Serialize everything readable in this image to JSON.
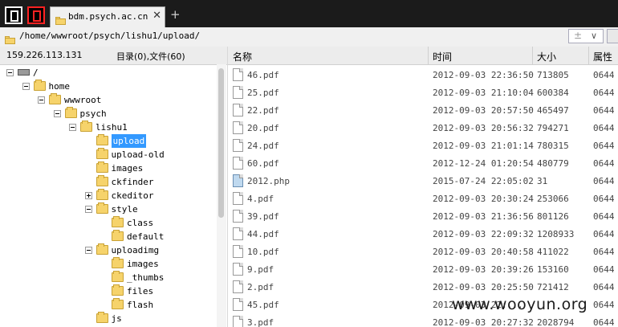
{
  "tab": {
    "title": "bdm.psych.ac.cn",
    "close": "✕"
  },
  "newtab": "+",
  "address": {
    "path": "/home/wwwroot/psych/lishu1/upload/",
    "plus": "±",
    "chevron": "∨"
  },
  "left": {
    "ip": "159.226.113.131",
    "counts": "目录(0),文件(60)",
    "tree": [
      {
        "label": "/",
        "level": 0,
        "icon": "drive-icon",
        "expander": "minus"
      },
      {
        "label": "home",
        "level": 1,
        "icon": "folder-icon",
        "expander": "minus"
      },
      {
        "label": "wwwroot",
        "level": 2,
        "icon": "folder-icon",
        "expander": "minus"
      },
      {
        "label": "psych",
        "level": 3,
        "icon": "folder-icon",
        "expander": "minus"
      },
      {
        "label": "lishu1",
        "level": 4,
        "icon": "folder-icon",
        "expander": "minus"
      },
      {
        "label": "upload",
        "level": 5,
        "icon": "folder-icon",
        "expander": "none",
        "selected": true
      },
      {
        "label": "upload-old",
        "level": 5,
        "icon": "folder-icon",
        "expander": "none"
      },
      {
        "label": "images",
        "level": 5,
        "icon": "folder-icon",
        "expander": "none"
      },
      {
        "label": "ckfinder",
        "level": 5,
        "icon": "folder-icon",
        "expander": "none"
      },
      {
        "label": "ckeditor",
        "level": 5,
        "icon": "folder-icon",
        "expander": "plus"
      },
      {
        "label": "style",
        "level": 5,
        "icon": "folder-icon",
        "expander": "minus"
      },
      {
        "label": "class",
        "level": 6,
        "icon": "folder-icon",
        "expander": "none"
      },
      {
        "label": "default",
        "level": 6,
        "icon": "folder-icon",
        "expander": "none"
      },
      {
        "label": "uploadimg",
        "level": 5,
        "icon": "folder-icon",
        "expander": "minus"
      },
      {
        "label": "images",
        "level": 6,
        "icon": "folder-icon",
        "expander": "none"
      },
      {
        "label": "_thumbs",
        "level": 6,
        "icon": "folder-icon",
        "expander": "none"
      },
      {
        "label": "files",
        "level": 6,
        "icon": "folder-icon",
        "expander": "none"
      },
      {
        "label": "flash",
        "level": 6,
        "icon": "folder-icon",
        "expander": "none"
      },
      {
        "label": "js",
        "level": 5,
        "icon": "folder-icon",
        "expander": "none"
      }
    ]
  },
  "columns": {
    "name": "名称",
    "time": "时间",
    "size": "大小",
    "attr": "属性"
  },
  "files": [
    {
      "name": "46.pdf",
      "time": "2012-09-03 22:36:50",
      "size": "713805",
      "attr": "0644",
      "icon": "file-icon"
    },
    {
      "name": "25.pdf",
      "time": "2012-09-03 21:10:04",
      "size": "600384",
      "attr": "0644",
      "icon": "file-icon"
    },
    {
      "name": "22.pdf",
      "time": "2012-09-03 20:57:50",
      "size": "465497",
      "attr": "0644",
      "icon": "file-icon"
    },
    {
      "name": "20.pdf",
      "time": "2012-09-03 20:56:32",
      "size": "794271",
      "attr": "0644",
      "icon": "file-icon"
    },
    {
      "name": "24.pdf",
      "time": "2012-09-03 21:01:14",
      "size": "780315",
      "attr": "0644",
      "icon": "file-icon"
    },
    {
      "name": "60.pdf",
      "time": "2012-12-24 01:20:54",
      "size": "480779",
      "attr": "0644",
      "icon": "file-icon"
    },
    {
      "name": "2012.php",
      "time": "2015-07-24 22:05:02",
      "size": "31",
      "attr": "0644",
      "icon": "php-file-icon"
    },
    {
      "name": "4.pdf",
      "time": "2012-09-03 20:30:24",
      "size": "253066",
      "attr": "0644",
      "icon": "file-icon"
    },
    {
      "name": "39.pdf",
      "time": "2012-09-03 21:36:56",
      "size": "801126",
      "attr": "0644",
      "icon": "file-icon"
    },
    {
      "name": "44.pdf",
      "time": "2012-09-03 22:09:32",
      "size": "1208933",
      "attr": "0644",
      "icon": "file-icon"
    },
    {
      "name": "10.pdf",
      "time": "2012-09-03 20:40:58",
      "size": "411022",
      "attr": "0644",
      "icon": "file-icon"
    },
    {
      "name": "9.pdf",
      "time": "2012-09-03 20:39:26",
      "size": "153160",
      "attr": "0644",
      "icon": "file-icon"
    },
    {
      "name": "2.pdf",
      "time": "2012-09-03 20:25:50",
      "size": "721412",
      "attr": "0644",
      "icon": "file-icon"
    },
    {
      "name": "45.pdf",
      "time": "2012-09-03 22:...",
      "size": "",
      "attr": "0644",
      "icon": "file-icon"
    },
    {
      "name": "3.pdf",
      "time": "2012-09-03 20:27:32",
      "size": "2028794",
      "attr": "0644",
      "icon": "file-icon"
    }
  ],
  "watermark": "www.wooyun.org"
}
